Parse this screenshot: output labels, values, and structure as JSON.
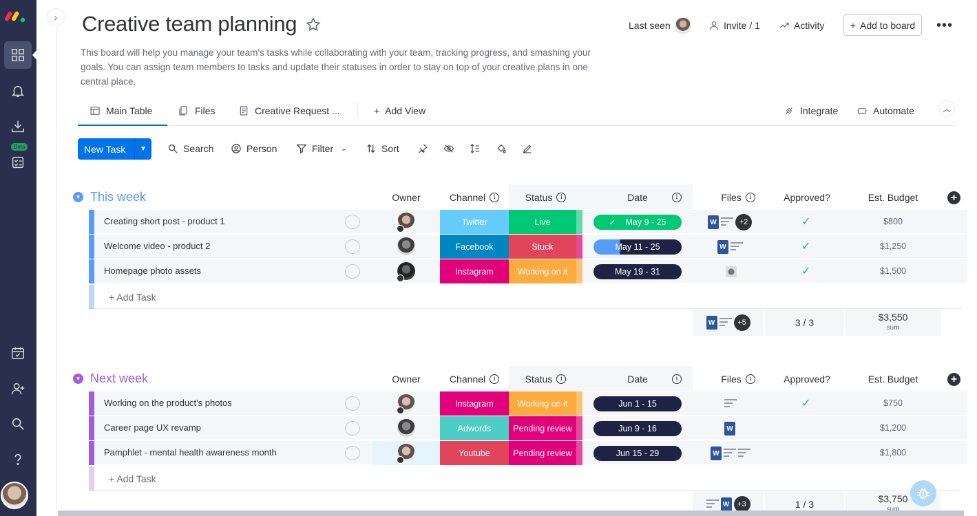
{
  "board": {
    "title": "Creative team planning",
    "description": "This board will help you manage your team's tasks while collaborating with your team, tracking progress, and smashing your goals. You can assign team members to tasks and update their statuses in order to stay on top of your creative plans in one central place."
  },
  "header": {
    "last_seen": "Last seen",
    "invite": "Invite / 1",
    "activity": "Activity",
    "add_to_board": "Add to board"
  },
  "tabs": [
    {
      "label": "Main Table"
    },
    {
      "label": "Files"
    },
    {
      "label": "Creative Request ..."
    },
    {
      "label": "Add View"
    }
  ],
  "tab_actions": {
    "integrate": "Integrate",
    "automate": "Automate"
  },
  "toolbar": {
    "new_task": "New Task",
    "search": "Search",
    "person": "Person",
    "filter": "Filter",
    "sort": "Sort"
  },
  "rail": {
    "beta": "Beta"
  },
  "columns": {
    "owner": "Owner",
    "channel": "Channel",
    "status": "Status",
    "date": "Date",
    "files": "Files",
    "approved": "Approved?",
    "budget": "Est. Budget"
  },
  "groups": [
    {
      "title": "This week",
      "color": "#579bfc",
      "add_task": "+ Add Task",
      "rows": [
        {
          "name": "Creating short post - product 1",
          "channel": "Twitter",
          "channel_color": "#66ccff",
          "status": "Live",
          "status_color": "#00c875",
          "date": "May 9 - 25",
          "date_style": "done",
          "files_extra": "+2",
          "approved": true,
          "budget": "$800"
        },
        {
          "name": "Welcome video - product 2",
          "channel": "Facebook",
          "channel_color": "#0086c0",
          "status": "Stuck",
          "status_color": "#e2445c",
          "date": "May 11 - 25",
          "date_style": "partial",
          "files_extra": "",
          "approved": true,
          "budget": "$1,250"
        },
        {
          "name": "Homepage photo assets",
          "channel": "Instagram",
          "channel_color": "#e2007a",
          "status": "Working on it",
          "status_color": "#fdab3d",
          "date": "May 19 - 31",
          "date_style": "dark",
          "files_extra": "",
          "approved": true,
          "budget": "$1,500"
        }
      ],
      "summary": {
        "files_extra": "+5",
        "approved": "3 / 3",
        "budget": "$3,550",
        "budget_sub": "sum"
      }
    },
    {
      "title": "Next week",
      "color": "#a25ddc",
      "add_task": "+ Add Task",
      "rows": [
        {
          "name": "Working on the product's photos",
          "channel": "Instagram",
          "channel_color": "#e2007a",
          "status": "Working on it",
          "status_color": "#fdab3d",
          "date": "Jun 1 - 15",
          "date_style": "dark",
          "files_extra": "",
          "approved": true,
          "budget": "$750"
        },
        {
          "name": "Career page UX revamp",
          "channel": "Adwords",
          "channel_color": "#4eccc6",
          "status": "Pending review",
          "status_color": "#e2007a",
          "date": "Jun 9 - 16",
          "date_style": "dark",
          "files_extra": "",
          "approved": false,
          "budget": "$1,200"
        },
        {
          "name": "Pamphlet - mental health awareness month",
          "channel": "Youtube",
          "channel_color": "#e2445c",
          "status": "Pending review",
          "status_color": "#e2007a",
          "date": "Jun 15 - 29",
          "date_style": "dark",
          "files_extra": "",
          "approved": false,
          "budget": "$1,800"
        }
      ],
      "summary": {
        "files_extra": "+3",
        "approved": "1 / 3",
        "budget": "$3,750",
        "budget_sub": "sum"
      }
    }
  ]
}
